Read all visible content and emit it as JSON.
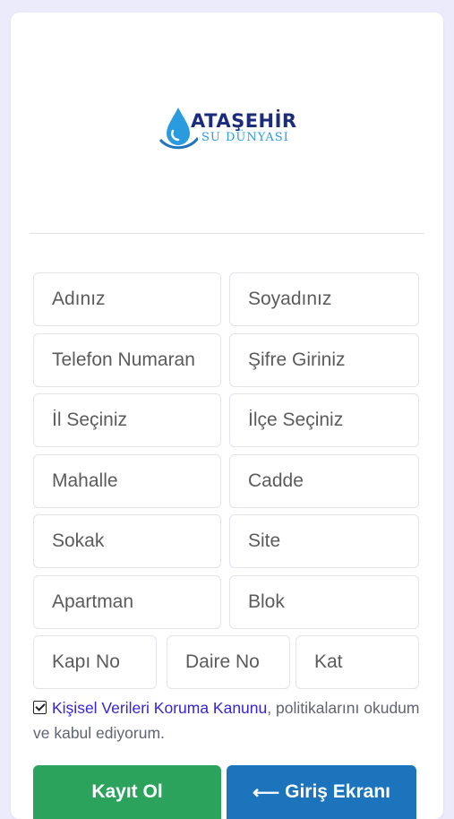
{
  "logo": {
    "title": "ATAŞEHİR",
    "subtitle": "SU DÜNYASI"
  },
  "form": {
    "row1": {
      "first_name": "Adınız",
      "last_name": "Soyadınız"
    },
    "row2": {
      "phone": "Telefon Numaran",
      "password": "Şifre Giriniz"
    },
    "row3": {
      "province": "İl Seçiniz",
      "district": "İlçe Seçiniz"
    },
    "row4": {
      "neighborhood": "Mahalle",
      "street": "Cadde"
    },
    "row5": {
      "lane": "Sokak",
      "site": "Site"
    },
    "row6": {
      "apartment": "Apartman",
      "block": "Blok"
    },
    "row7": {
      "door_no": "Kapı No",
      "flat_no": "Daire No",
      "floor": "Kat"
    }
  },
  "consent": {
    "checked": true,
    "link_text": "Kişisel Verileri Koruma Kanunu",
    "text": ", politikalarını okudum ve kabul ediyorum."
  },
  "buttons": {
    "register": "Kayıt Ol",
    "login_arrow": "⟵",
    "login": "Giriş Ekranı"
  },
  "colors": {
    "background": "#ebebfb",
    "card": "#ffffff",
    "register": "#2ba35d",
    "login": "#1c74bd",
    "link": "#3523d8",
    "logo_navy": "#1b2d7a",
    "logo_blue": "#2b9be0"
  }
}
